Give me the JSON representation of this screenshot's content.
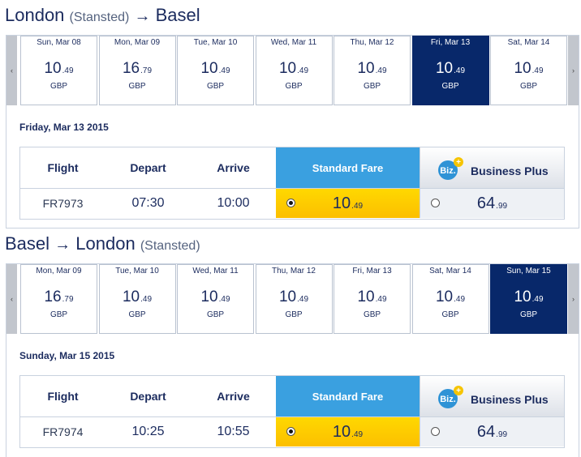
{
  "outbound": {
    "title": {
      "from": "London",
      "from_sub": "(Stansted)",
      "arrow": "→",
      "to": "Basel",
      "to_sub": ""
    },
    "nav": {
      "prev": "‹",
      "next": "›"
    },
    "days": [
      {
        "date": "Sun, Mar 08",
        "major": "10",
        "minor": ".49",
        "currency": "GBP",
        "selected": false
      },
      {
        "date": "Mon, Mar 09",
        "major": "16",
        "minor": ".79",
        "currency": "GBP",
        "selected": false
      },
      {
        "date": "Tue, Mar 10",
        "major": "10",
        "minor": ".49",
        "currency": "GBP",
        "selected": false
      },
      {
        "date": "Wed, Mar 11",
        "major": "10",
        "minor": ".49",
        "currency": "GBP",
        "selected": false
      },
      {
        "date": "Thu, Mar 12",
        "major": "10",
        "minor": ".49",
        "currency": "GBP",
        "selected": false
      },
      {
        "date": "Fri, Mar 13",
        "major": "10",
        "minor": ".49",
        "currency": "GBP",
        "selected": true
      },
      {
        "date": "Sat, Mar 14",
        "major": "10",
        "minor": ".49",
        "currency": "GBP",
        "selected": false
      }
    ],
    "selected_date_label": "Friday, Mar 13 2015",
    "headers": {
      "flight": "Flight",
      "depart": "Depart",
      "arrive": "Arrive",
      "standard": "Standard Fare",
      "biz_logo": "Biz.",
      "business": "Business Plus"
    },
    "row": {
      "flight": "FR7973",
      "depart": "07:30",
      "arrive": "10:00",
      "std_major": "10",
      "std_minor": ".49",
      "biz_major": "64",
      "biz_minor": ".99",
      "selected_fare": "standard"
    }
  },
  "inbound": {
    "title": {
      "from": "Basel",
      "from_sub": "",
      "arrow": "→",
      "to": "London",
      "to_sub": "(Stansted)"
    },
    "nav": {
      "prev": "‹",
      "next": "›"
    },
    "days": [
      {
        "date": "Mon, Mar 09",
        "major": "16",
        "minor": ".79",
        "currency": "GBP",
        "selected": false
      },
      {
        "date": "Tue, Mar 10",
        "major": "10",
        "minor": ".49",
        "currency": "GBP",
        "selected": false
      },
      {
        "date": "Wed, Mar 11",
        "major": "10",
        "minor": ".49",
        "currency": "GBP",
        "selected": false
      },
      {
        "date": "Thu, Mar 12",
        "major": "10",
        "minor": ".49",
        "currency": "GBP",
        "selected": false
      },
      {
        "date": "Fri, Mar 13",
        "major": "10",
        "minor": ".49",
        "currency": "GBP",
        "selected": false
      },
      {
        "date": "Sat, Mar 14",
        "major": "10",
        "minor": ".49",
        "currency": "GBP",
        "selected": false
      },
      {
        "date": "Sun, Mar 15",
        "major": "10",
        "minor": ".49",
        "currency": "GBP",
        "selected": true
      }
    ],
    "selected_date_label": "Sunday, Mar 15 2015",
    "headers": {
      "flight": "Flight",
      "depart": "Depart",
      "arrive": "Arrive",
      "standard": "Standard Fare",
      "biz_logo": "Biz.",
      "business": "Business Plus"
    },
    "row": {
      "flight": "FR7974",
      "depart": "10:25",
      "arrive": "10:55",
      "std_major": "10",
      "std_minor": ".49",
      "biz_major": "64",
      "biz_minor": ".99",
      "selected_fare": "standard"
    }
  },
  "colors": {
    "selected_day": "#08286a",
    "standard_header": "#3aa0e0",
    "standard_fare": "#fcc800",
    "text": "#1b2b5e",
    "biz_badge": "#2f93d6",
    "biz_plus": "#f6c400"
  }
}
